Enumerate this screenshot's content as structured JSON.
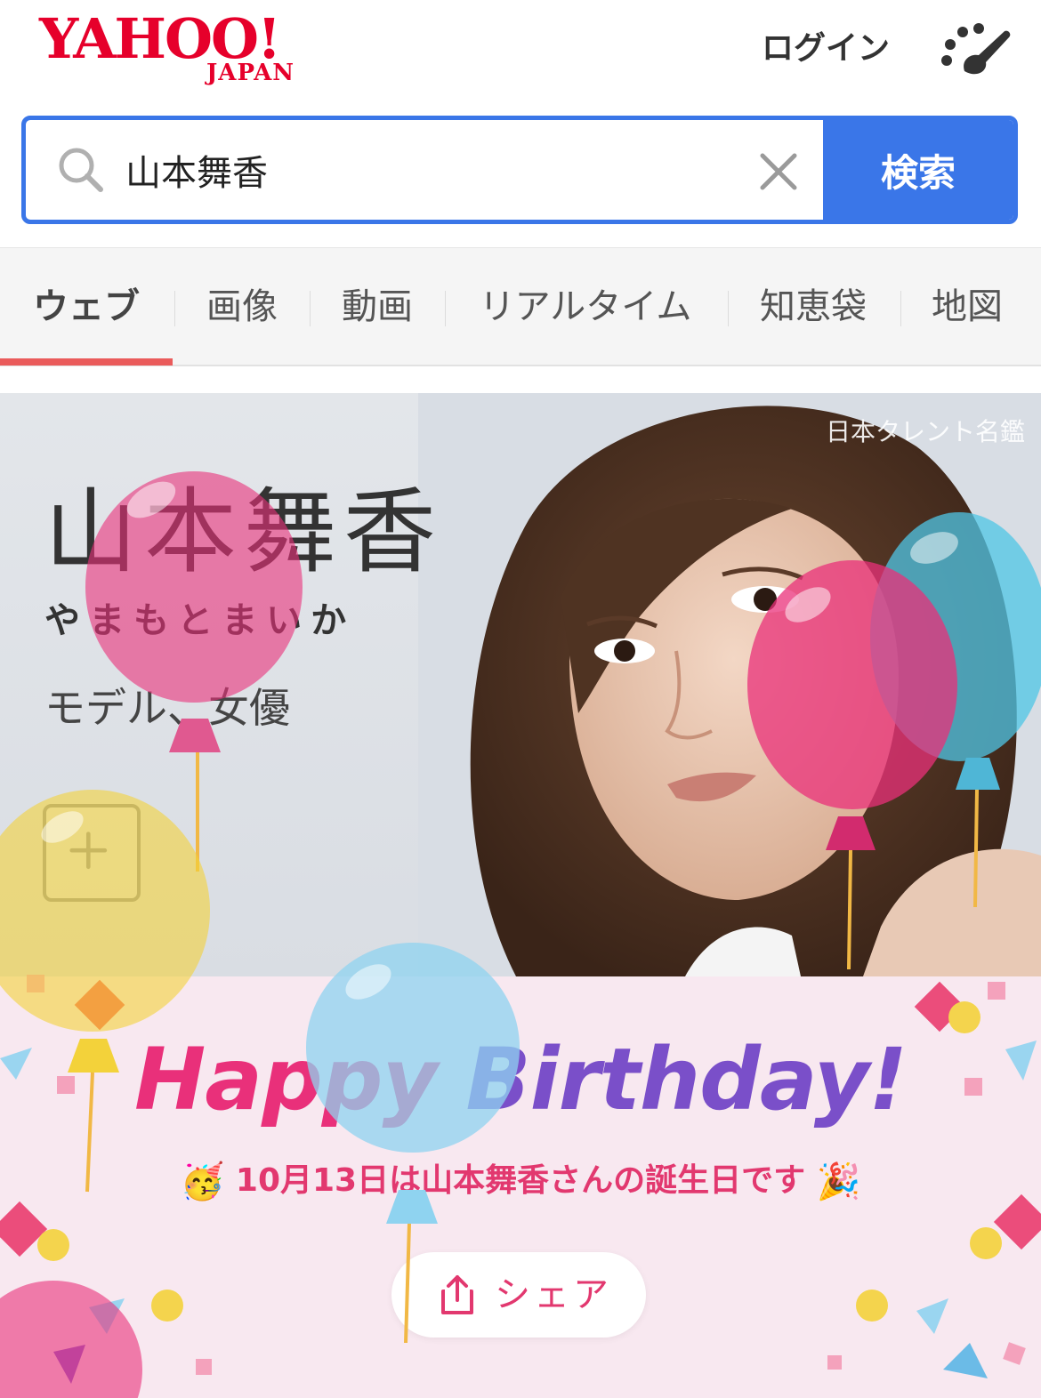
{
  "header": {
    "logo_main": "YAHOO!",
    "logo_sub": "JAPAN",
    "login_label": "ログイン",
    "menu_icon": "paint-palette-icon"
  },
  "search": {
    "query": "山本舞香",
    "button_label": "検索",
    "search_icon": "search-icon",
    "clear_icon": "close-icon"
  },
  "tabs": [
    {
      "label": "ウェブ",
      "active": true
    },
    {
      "label": "画像",
      "active": false
    },
    {
      "label": "動画",
      "active": false
    },
    {
      "label": "リアルタイム",
      "active": false
    },
    {
      "label": "知恵袋",
      "active": false
    },
    {
      "label": "地図",
      "active": false
    }
  ],
  "hero": {
    "source": "日本タレント名鑑",
    "name": "山本舞香",
    "reading": "やまもとまいか",
    "occupation": "モデル、女優",
    "add_icon": "plus-icon"
  },
  "birthday": {
    "title_part1": "Happy ",
    "title_part2": "Birthday!",
    "emoji_left": "🥳",
    "emoji_right": "🎉",
    "message": "10月13日は山本舞香さんの誕生日です",
    "share_label": "シェア",
    "share_icon": "share-icon"
  },
  "colors": {
    "brand_red": "#e6002b",
    "search_blue": "#3a76e8",
    "tab_underline": "#ea5b5b",
    "birthday_pink": "#e9307a",
    "birthday_purple": "#7a4fc9",
    "birthday_bg": "#f8e8f0"
  }
}
